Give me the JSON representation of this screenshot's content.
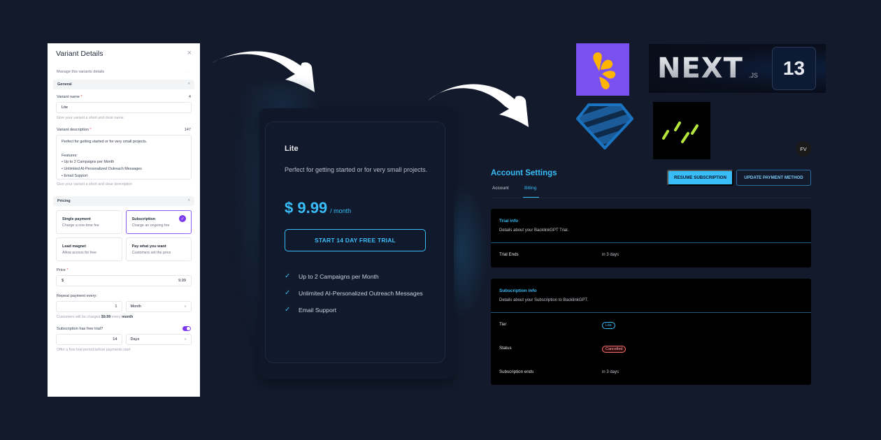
{
  "variant_panel": {
    "title": "Variant Details",
    "close_icon": "×",
    "manage_text": "Manage this variants details",
    "more_icon": "···",
    "general_section": "General",
    "variant_name_label": "Variant name",
    "required_mark": "*",
    "variant_name_count": "4",
    "variant_name_value": "Lite",
    "variant_name_hint": "Give your variant a short and clear name",
    "variant_desc_label": "Variant description",
    "variant_desc_count": "147",
    "variant_desc_lines": [
      "Perfect for getting started or for very small projects.",
      "",
      "Features:",
      "• Up to 2 Campaigns per Month",
      "• Unlimited AI-Personalized Outreach Messages",
      "• Email Support"
    ],
    "variant_desc_hint": "Give your variant a short and clear description",
    "pricing_section": "Pricing",
    "pricing_options": [
      {
        "title": "Single payment",
        "subtitle": "Charge a one-time fee",
        "selected": false
      },
      {
        "title": "Subscription",
        "subtitle": "Charge an ongoing fee",
        "selected": true
      },
      {
        "title": "Lead magnet",
        "subtitle": "Allow access for free",
        "selected": false
      },
      {
        "title": "Pay what you want",
        "subtitle": "Customers set the price",
        "selected": false
      }
    ],
    "price_label": "Price",
    "price_currency": "$",
    "price_value": "9.99",
    "repeat_label": "Repeat payment every:",
    "repeat_value": "1",
    "repeat_unit": "Month",
    "repeat_hint_prefix": "Customers will be charged",
    "repeat_hint_amount": "$9.99",
    "repeat_hint_suffix": "every",
    "repeat_hint_unit": "month",
    "trial_label": "Subscription has free trial?",
    "trial_enabled": true,
    "trial_value": "14",
    "trial_unit": "Days",
    "trial_hint": "Offer a free trial period before payments start"
  },
  "pricing_card": {
    "name": "Lite",
    "description": "Perfect for getting started or for very small projects.",
    "price": "$ 9.99",
    "period": "/ month",
    "cta": "START 14 DAY FREE TRIAL",
    "features": [
      "Up to 2 Campaigns per Month",
      "Unlimited AI-Personalized Outreach Messages",
      "Email Support"
    ],
    "check_icon": "✓"
  },
  "logos": {
    "next_word": "NEXT",
    "next_suffix": ".JS",
    "next_version": "13",
    "avatar_initials": "FV"
  },
  "account_settings": {
    "title": "Account Settings",
    "tabs": [
      {
        "label": "Account",
        "active": false
      },
      {
        "label": "Billing",
        "active": true
      }
    ],
    "resume_button": "RESUME SUBSCRIPTION",
    "update_button": "UPDATE PAYMENT METHOD",
    "trial_info": {
      "title": "Trial info",
      "subtitle": "Details about your BacklinkGPT Trial.",
      "rows": [
        {
          "label": "Trial Ends",
          "value": "in 3 days"
        }
      ]
    },
    "subscription_info": {
      "title": "Subscription info",
      "subtitle": "Details about your Subscription to BacklinkGPT.",
      "tier_label": "Tier",
      "tier_value": "Lite",
      "status_label": "Status",
      "status_value": "Cancelled",
      "ends_label": "Subscription ends",
      "ends_value": "in 3 days"
    }
  },
  "colors": {
    "background": "#121a2b",
    "accent": "#38bdf8",
    "purple": "#7c3aed",
    "danger": "#f87171",
    "lemon_bg": "#7b50f0",
    "lemon_petal": "#ffb400",
    "dash_green": "#b5e63a",
    "gem_blue": "#1a73c0"
  }
}
